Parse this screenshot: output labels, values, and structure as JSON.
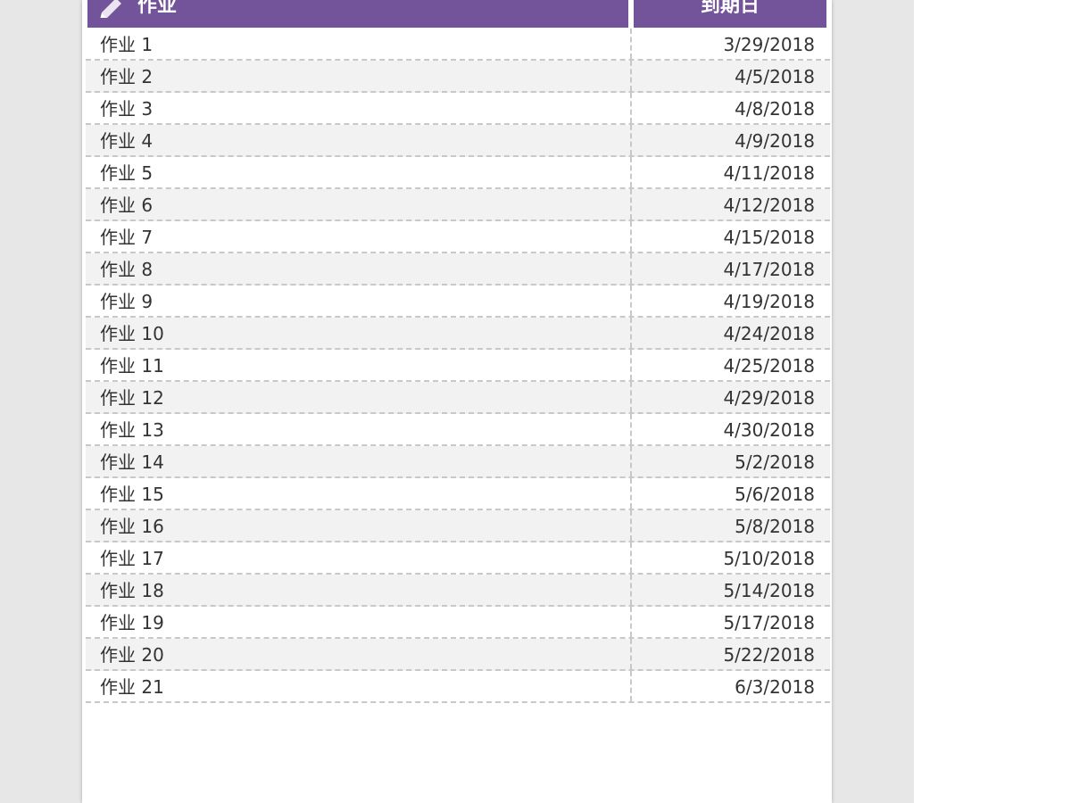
{
  "header": {
    "task_label": "作业",
    "due_label": "到期日"
  },
  "rows": [
    {
      "task": "作业 1",
      "due": "3/29/2018"
    },
    {
      "task": "作业 2",
      "due": "4/5/2018"
    },
    {
      "task": "作业 3",
      "due": "4/8/2018"
    },
    {
      "task": "作业 4",
      "due": "4/9/2018"
    },
    {
      "task": "作业 5",
      "due": "4/11/2018"
    },
    {
      "task": "作业 6",
      "due": "4/12/2018"
    },
    {
      "task": "作业 7",
      "due": "4/15/2018"
    },
    {
      "task": "作业 8",
      "due": "4/17/2018"
    },
    {
      "task": "作业 9",
      "due": "4/19/2018"
    },
    {
      "task": "作业 10",
      "due": "4/24/2018"
    },
    {
      "task": "作业 11",
      "due": "4/25/2018"
    },
    {
      "task": "作业 12",
      "due": "4/29/2018"
    },
    {
      "task": "作业 13",
      "due": "4/30/2018"
    },
    {
      "task": "作业 14",
      "due": "5/2/2018"
    },
    {
      "task": "作业 15",
      "due": "5/6/2018"
    },
    {
      "task": "作业 16",
      "due": "5/8/2018"
    },
    {
      "task": "作业 17",
      "due": "5/10/2018"
    },
    {
      "task": "作业 18",
      "due": "5/14/2018"
    },
    {
      "task": "作业 19",
      "due": "5/17/2018"
    },
    {
      "task": "作业 20",
      "due": "5/22/2018"
    },
    {
      "task": "作业 21",
      "due": "6/3/2018"
    }
  ],
  "colors": {
    "header": "#735399",
    "stripe": "#f2f2f2",
    "divider": "#c8c8c8",
    "text": "#333333"
  },
  "icons": {
    "header": "pencil-icon"
  }
}
